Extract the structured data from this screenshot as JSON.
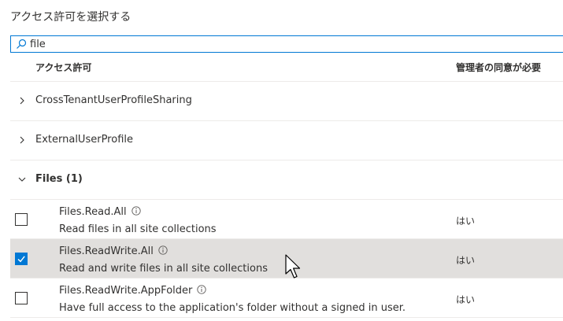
{
  "title": "アクセス許可を選択する",
  "search": {
    "value": "file",
    "placeholder": ""
  },
  "table": {
    "header_permission": "アクセス許可",
    "header_admin_consent": "管理者の同意が必要"
  },
  "groups": [
    {
      "label": "CrossTenantUserProfileSharing",
      "expanded": false
    },
    {
      "label": "ExternalUserProfile",
      "expanded": false
    },
    {
      "label": "Files (1)",
      "expanded": true
    }
  ],
  "permissions": [
    {
      "name": "Files.Read.All",
      "description": "Read files in all site collections",
      "admin_consent": "はい",
      "checked": false
    },
    {
      "name": "Files.ReadWrite.All",
      "description": "Read and write files in all site collections",
      "admin_consent": "はい",
      "checked": true
    },
    {
      "name": "Files.ReadWrite.AppFolder",
      "description": "Have full access to the application's folder without a signed in user.",
      "admin_consent": "はい",
      "checked": false
    }
  ],
  "colors": {
    "accent": "#0078d4",
    "selected_row": "#e1dfdd",
    "divider": "#edebe9",
    "text": "#323130"
  },
  "icons": {
    "search": "search-icon",
    "chevron_right": "chevron-right-icon",
    "chevron_down": "chevron-down-icon",
    "info": "info-icon",
    "check": "checkmark-icon"
  }
}
